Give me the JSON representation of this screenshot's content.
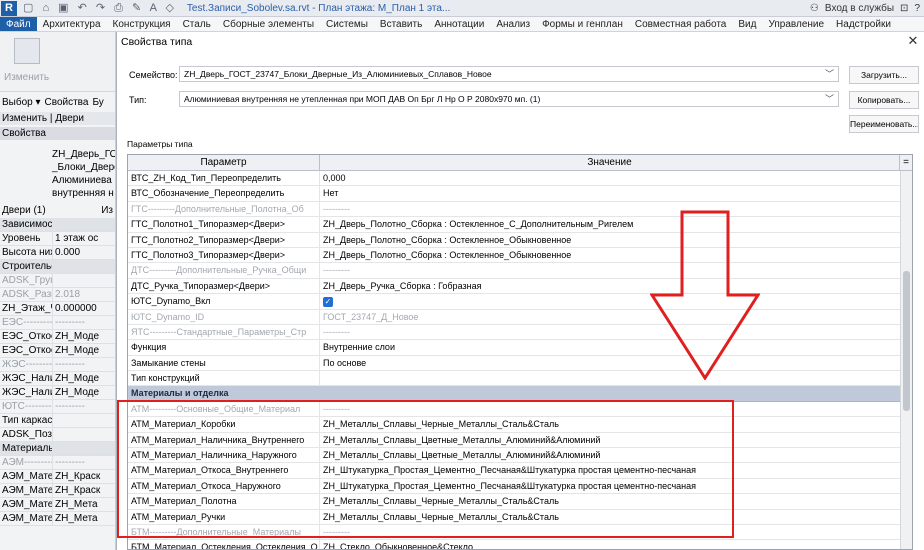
{
  "titlebar": {
    "logo": "R",
    "document_title": "Test.Записи_Sobolev.sa.rvt - План этажа: М_План 1 эта...",
    "signin_label": "Вход в службы",
    "help_label": "?"
  },
  "menubar": {
    "file": "Файл",
    "items": [
      "Архитектура",
      "Конструкция",
      "Сталь",
      "Сборные элементы",
      "Системы",
      "Вставить",
      "Аннотации",
      "Анализ",
      "Формы и генплан",
      "Совместная работа",
      "Вид",
      "Управление",
      "Надстройки"
    ]
  },
  "left": {
    "ribbon_label": "Изменить",
    "selection_label": "Выбор ▾",
    "properties_label": "Свойства",
    "b_label": "Бу",
    "modify_doors": "Изменить | Двери",
    "properties_header": "Свойства",
    "type_preview": [
      "ZH_Дверь_ГО",
      "_Блоки_Двере",
      "Алюминиева",
      "внутренняя н"
    ],
    "instance_filter": "Двери (1)",
    "edit_type": "Из",
    "rows": [
      {
        "a": "Зависимости",
        "b": "",
        "kind": "cat"
      },
      {
        "a": "Уровень",
        "b": "1 этаж ос",
        "kind": ""
      },
      {
        "a": "Высота нижн...",
        "b": "0.000",
        "kind": ""
      },
      {
        "a": "Строительство",
        "b": "",
        "kind": "cat"
      },
      {
        "a": "ADSK_Группи...",
        "b": "",
        "kind": "dim"
      },
      {
        "a": "ADSK_Размер...",
        "b": "2.018",
        "kind": "dim"
      },
      {
        "a": "ZH_Этаж_Чис...",
        "b": "0.000000",
        "kind": ""
      },
      {
        "a": "ЕЭС---------Д...",
        "b": "---------",
        "kind": "dim"
      },
      {
        "a": "ЕЭС_Откос_Вн...",
        "b": "ZH_Моде",
        "kind": ""
      },
      {
        "a": "ЕЭС_Откос_На...",
        "b": "ZH_Моде",
        "kind": ""
      },
      {
        "a": "ЖЭС---------...",
        "b": "---------",
        "kind": "dim"
      },
      {
        "a": "ЖЭС_Наличн...",
        "b": "ZH_Моде",
        "kind": ""
      },
      {
        "a": "ЖЭС_Наличн...",
        "b": "ZH_Моде",
        "kind": ""
      },
      {
        "a": "ЮТС-----------",
        "b": "---------",
        "kind": "dim"
      },
      {
        "a": "Тип каркаса",
        "b": "",
        "kind": ""
      },
      {
        "a": "ADSK_Позиция",
        "b": "",
        "kind": ""
      },
      {
        "a": "Материалы и отделка",
        "b": "",
        "kind": "cat"
      },
      {
        "a": "АЭМ---------...",
        "b": "---------",
        "kind": "dim"
      },
      {
        "a": "АЭМ_Матери...",
        "b": "ZH_Краск",
        "kind": ""
      },
      {
        "a": "АЭМ_Матери...",
        "b": "ZH_Краск",
        "kind": ""
      },
      {
        "a": "АЭМ_Матери...",
        "b": "ZH_Мета",
        "kind": ""
      },
      {
        "a": "АЭМ_Матери...",
        "b": "ZH_Мета",
        "kind": ""
      }
    ]
  },
  "dialog": {
    "title": "Свойства типа",
    "family_label": "Семейство:",
    "family_value": "ZH_Дверь_ГОСТ_23747_Блоки_Дверные_Из_Алюминиевых_Сплавов_Новое",
    "type_label": "Тип:",
    "type_value": "Алюминиевая внутренняя не утепленная при МОП ДАВ Оп Брг Л Нр О Р 2080х970 мп. (1)",
    "load_button": "Загрузить...",
    "copy_button": "Копировать...",
    "rename_button": "Переименовать...",
    "params_caption": "Параметры типа",
    "col_param": "Параметр",
    "col_value": "Значение",
    "col_extra": "=",
    "rows": [
      {
        "p": "ВТС_ZH_Код_Тип_Переопределить",
        "v": "0,000",
        "kind": ""
      },
      {
        "p": "ВТС_Обозначение_Переопределить",
        "v": "Нет",
        "kind": ""
      },
      {
        "p": "ГТС---------Дополнительные_Полотна_Об",
        "v": "---------",
        "kind": "dim"
      },
      {
        "p": "ГТС_Полотно1_Типоразмер<Двери>",
        "v": "ZH_Дверь_Полотно_Сборка : Остекленное_С_Дополнительным_Ригелем",
        "kind": ""
      },
      {
        "p": "ГТС_Полотно2_Типоразмер<Двери>",
        "v": "ZH_Дверь_Полотно_Сборка : Остекленное_Обыкновенное",
        "kind": ""
      },
      {
        "p": "ГТС_Полотно3_Типоразмер<Двери>",
        "v": "ZH_Дверь_Полотно_Сборка : Остекленное_Обыкновенное",
        "kind": ""
      },
      {
        "p": "ДТС---------Дополнительные_Ручка_Общи",
        "v": "---------",
        "kind": "dim"
      },
      {
        "p": "ДТС_Ручка_Типоразмер<Двери>",
        "v": "ZH_Дверь_Ручка_Сборка : Гобразная",
        "kind": ""
      },
      {
        "p": "ЮТС_Dynamo_Вкл",
        "v": "",
        "kind": "check"
      },
      {
        "p": "ЮТС_Dynamo_ID",
        "v": "ГОСТ_23747_Д_Новое",
        "kind": "dim"
      },
      {
        "p": "ЯТС---------Стандартные_Параметры_Стр",
        "v": "---------",
        "kind": "dim"
      },
      {
        "p": "Функция",
        "v": "Внутренние слои",
        "kind": ""
      },
      {
        "p": "Замыкание стены",
        "v": "По основе",
        "kind": ""
      },
      {
        "p": "Тип конструкций",
        "v": "",
        "kind": ""
      },
      {
        "p": "Материалы и отделка",
        "v": "",
        "kind": "group"
      },
      {
        "p": "АТМ---------Основные_Общие_Материал",
        "v": "---------",
        "kind": "dim"
      },
      {
        "p": "АТМ_Материал_Коробки",
        "v": "ZH_Металлы_Сплавы_Черные_Металлы_Сталь&Сталь",
        "kind": ""
      },
      {
        "p": "АТМ_Материал_Наличника_Внутреннего",
        "v": "ZH_Металлы_Сплавы_Цветные_Металлы_Алюминий&Алюминий",
        "kind": ""
      },
      {
        "p": "АТМ_Материал_Наличника_Наружного",
        "v": "ZH_Металлы_Сплавы_Цветные_Металлы_Алюминий&Алюминий",
        "kind": ""
      },
      {
        "p": "АТМ_Материал_Откоса_Внутреннего",
        "v": "ZH_Штукатурка_Простая_Цементно_Песчаная&Штукатурка простая цементно-песчаная",
        "kind": ""
      },
      {
        "p": "АТМ_Материал_Откоса_Наружного",
        "v": "ZH_Штукатурка_Простая_Цементно_Песчаная&Штукатурка простая цементно-песчаная",
        "kind": ""
      },
      {
        "p": "АТМ_Материал_Полотна",
        "v": "ZH_Металлы_Сплавы_Черные_Металлы_Сталь&Сталь",
        "kind": ""
      },
      {
        "p": "АТМ_Материал_Ручки",
        "v": "ZH_Металлы_Сплавы_Черные_Металлы_Сталь&Сталь",
        "kind": ""
      },
      {
        "p": "БТМ---------Дополнительные_Материалы",
        "v": "---------",
        "kind": "dim"
      },
      {
        "p": "БТМ_Материал_Остекления_Остекления_О",
        "v": "ZH_Стекло_Обыкновенное&Стекло",
        "kind": ""
      }
    ]
  },
  "colors": {
    "highlight": "#e01f1f",
    "group": "#bfc9d9",
    "accent": "#1f5fa8"
  }
}
